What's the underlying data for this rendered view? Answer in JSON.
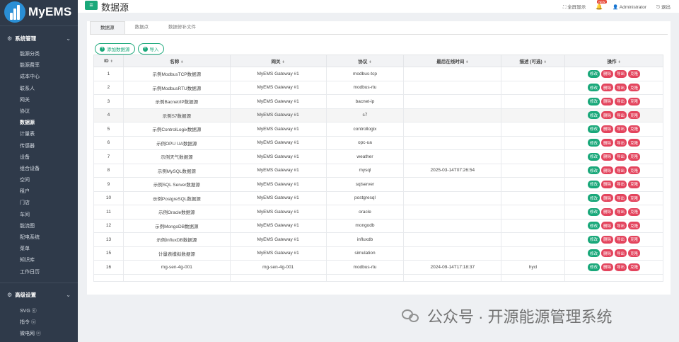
{
  "app": {
    "name": "MyEMS",
    "page_title": "数据源"
  },
  "topbar": {
    "fullscreen": "全屏显示",
    "badge": "NEW",
    "user": "Administrator",
    "logout": "退出"
  },
  "sidebar": {
    "section1": "系统管理",
    "items": [
      "能源分类",
      "能源费率",
      "成本中心",
      "联系人",
      "网关",
      "协议",
      "数据源",
      "计量表",
      "传感器",
      "设备",
      "组合设备",
      "空间",
      "租户",
      "门店",
      "车间",
      "能流图",
      "配电系统",
      "菜单",
      "知识库",
      "工作日历"
    ],
    "active_index": 6,
    "section2": "高级设置",
    "items2": [
      "SVG ⓔ",
      "指令 ⓔ",
      "微电网 ⓔ",
      "虚拟电厂 ⓔ"
    ]
  },
  "tabs": [
    "数据源",
    "数据点",
    "数据修补文件"
  ],
  "buttons": {
    "add": "添加数据源",
    "import": "导入"
  },
  "table": {
    "headers": [
      "ID",
      "名称",
      "网关",
      "协议",
      "最后在线时间",
      "描述 (可选)",
      "操作"
    ],
    "op_labels": [
      "修改",
      "删除",
      "导出",
      "克隆"
    ],
    "rows": [
      [
        "1",
        "示例ModbusTCP数据源",
        "MyEMS Gateway #1",
        "modbus-tcp",
        "",
        ""
      ],
      [
        "2",
        "示例ModbusRTU数据源",
        "MyEMS Gateway #1",
        "modbus-rtu",
        "",
        ""
      ],
      [
        "3",
        "示例Bacnet/IP数据源",
        "MyEMS Gateway #1",
        "bacnet-ip",
        "",
        ""
      ],
      [
        "4",
        "示例S7数据源",
        "MyEMS Gateway #1",
        "s7",
        "",
        ""
      ],
      [
        "5",
        "示例ControlLogix数据源",
        "MyEMS Gateway #1",
        "controllogix",
        "",
        ""
      ],
      [
        "6",
        "示例OPU UA数据源",
        "MyEMS Gateway #1",
        "opc-ua",
        "",
        ""
      ],
      [
        "7",
        "示例天气数据源",
        "MyEMS Gateway #1",
        "weather",
        "",
        ""
      ],
      [
        "8",
        "示例MySQL数据源",
        "MyEMS Gateway #1",
        "mysql",
        "2025-03-14T07:26:54",
        ""
      ],
      [
        "9",
        "示例SQL Server数据源",
        "MyEMS Gateway #1",
        "sqlserver",
        "",
        ""
      ],
      [
        "10",
        "示例PostgreSQL数据源",
        "MyEMS Gateway #1",
        "postgresql",
        "",
        ""
      ],
      [
        "11",
        "示例Oracle数据源",
        "MyEMS Gateway #1",
        "oracle",
        "",
        ""
      ],
      [
        "12",
        "示例MongoDB数据源",
        "MyEMS Gateway #1",
        "mongodb",
        "",
        ""
      ],
      [
        "13",
        "示例InfluxDB数据源",
        "MyEMS Gateway #1",
        "influxdb",
        "",
        ""
      ],
      [
        "15",
        "计量表模拟数据源",
        "MyEMS Gateway #1",
        "simulation",
        "",
        ""
      ],
      [
        "16",
        "mg-sen-4g-001",
        "mg-sen-4g-001",
        "modbus-rtu",
        "2024-09-14T17:18:37",
        "hycl"
      ]
    ],
    "highlight_row": 3
  },
  "watermark": "公众号 · 开源能源管理系统",
  "colors": {
    "sidebar": "#2f3a4a",
    "accent": "#1aa87a",
    "danger": "#e3445d"
  }
}
